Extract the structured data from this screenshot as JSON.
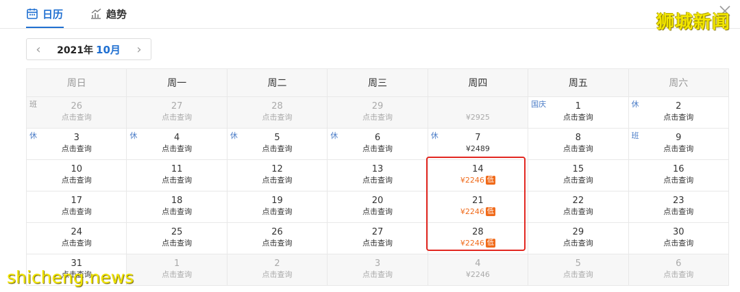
{
  "tabs": [
    {
      "label": "日历",
      "icon": "calendar-icon",
      "active": true
    },
    {
      "label": "趋势",
      "icon": "trend-chart-icon",
      "active": false
    }
  ],
  "watermark_top": "狮城新闻",
  "watermark_bottom": "shicheng.news",
  "month_picker": {
    "year": "2021年",
    "month": "10月"
  },
  "weekdays": [
    "周日",
    "周一",
    "周二",
    "周三",
    "周四",
    "周五",
    "周六"
  ],
  "colors": {
    "accent": "#1f6fd1",
    "low_price": "#f06a1a",
    "highlight_border": "#e2261f"
  },
  "weeks": [
    [
      {
        "day": "26",
        "sub": "点击查询",
        "dim": true,
        "tag": "班"
      },
      {
        "day": "27",
        "sub": "点击查询",
        "dim": true
      },
      {
        "day": "28",
        "sub": "点击查询",
        "dim": true
      },
      {
        "day": "29",
        "sub": "点击查询",
        "dim": true
      },
      {
        "day": "",
        "sub": "¥2925",
        "dim": true
      },
      {
        "day": "1",
        "sub": "点击查询",
        "tag": "国庆"
      },
      {
        "day": "2",
        "sub": "点击查询",
        "tag": "休"
      }
    ],
    [
      {
        "day": "3",
        "sub": "点击查询",
        "tag": "休"
      },
      {
        "day": "4",
        "sub": "点击查询",
        "tag": "休"
      },
      {
        "day": "5",
        "sub": "点击查询",
        "tag": "休"
      },
      {
        "day": "6",
        "sub": "点击查询",
        "tag": "休"
      },
      {
        "day": "7",
        "sub": "¥2489",
        "tag": "休"
      },
      {
        "day": "8",
        "sub": "点击查询"
      },
      {
        "day": "9",
        "sub": "点击查询",
        "tag": "班"
      }
    ],
    [
      {
        "day": "10",
        "sub": "点击查询"
      },
      {
        "day": "11",
        "sub": "点击查询"
      },
      {
        "day": "12",
        "sub": "点击查询"
      },
      {
        "day": "13",
        "sub": "点击查询"
      },
      {
        "day": "14",
        "sub": "¥2246",
        "low": true,
        "badge": "低"
      },
      {
        "day": "15",
        "sub": "点击查询"
      },
      {
        "day": "16",
        "sub": "点击查询"
      }
    ],
    [
      {
        "day": "17",
        "sub": "点击查询"
      },
      {
        "day": "18",
        "sub": "点击查询"
      },
      {
        "day": "19",
        "sub": "点击查询"
      },
      {
        "day": "20",
        "sub": "点击查询"
      },
      {
        "day": "21",
        "sub": "¥2246",
        "low": true,
        "badge": "低"
      },
      {
        "day": "22",
        "sub": "点击查询"
      },
      {
        "day": "23",
        "sub": "点击查询"
      }
    ],
    [
      {
        "day": "24",
        "sub": "点击查询"
      },
      {
        "day": "25",
        "sub": "点击查询"
      },
      {
        "day": "26",
        "sub": "点击查询"
      },
      {
        "day": "27",
        "sub": "点击查询"
      },
      {
        "day": "28",
        "sub": "¥2246",
        "low": true,
        "badge": "低"
      },
      {
        "day": "29",
        "sub": "点击查询"
      },
      {
        "day": "30",
        "sub": "点击查询"
      }
    ],
    [
      {
        "day": "31",
        "sub": "点击查询"
      },
      {
        "day": "1",
        "sub": "点击查询",
        "dim": true
      },
      {
        "day": "2",
        "sub": "点击查询",
        "dim": true
      },
      {
        "day": "3",
        "sub": "点击查询",
        "dim": true
      },
      {
        "day": "4",
        "sub": "¥2246",
        "dim": true
      },
      {
        "day": "5",
        "sub": "点击查询",
        "dim": true
      },
      {
        "day": "6",
        "sub": "点击查询",
        "dim": true
      }
    ]
  ]
}
